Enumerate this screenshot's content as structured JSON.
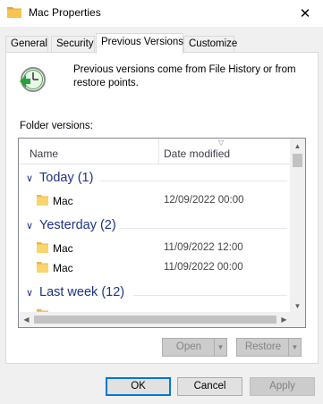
{
  "window": {
    "title": "Mac Properties",
    "close_glyph": "✕"
  },
  "tabs": [
    {
      "label": "General",
      "active": false
    },
    {
      "label": "Security",
      "active": false
    },
    {
      "label": "Previous Versions",
      "active": true
    },
    {
      "label": "Customize",
      "active": false
    }
  ],
  "info": {
    "text": "Previous versions come from File History or from restore points.",
    "icon": "restore-clock-icon"
  },
  "folder_versions_label": "Folder versions:",
  "list": {
    "columns": [
      "Name",
      "Date modified"
    ],
    "groups": [
      {
        "label": "Today (1)",
        "items": [
          {
            "name": "Mac",
            "date": "12/09/2022 00:00"
          }
        ]
      },
      {
        "label": "Yesterday (2)",
        "items": [
          {
            "name": "Mac",
            "date": "11/09/2022 12:00"
          },
          {
            "name": "Mac",
            "date": "11/09/2022 00:00"
          }
        ]
      },
      {
        "label": "Last week (12)",
        "items": []
      }
    ]
  },
  "buttons": {
    "open": "Open",
    "restore": "Restore",
    "ok": "OK",
    "cancel": "Cancel",
    "apply": "Apply"
  },
  "colors": {
    "group_heading": "#1e3287",
    "folder": "#f5c452",
    "default_button_border": "#0078d7"
  }
}
